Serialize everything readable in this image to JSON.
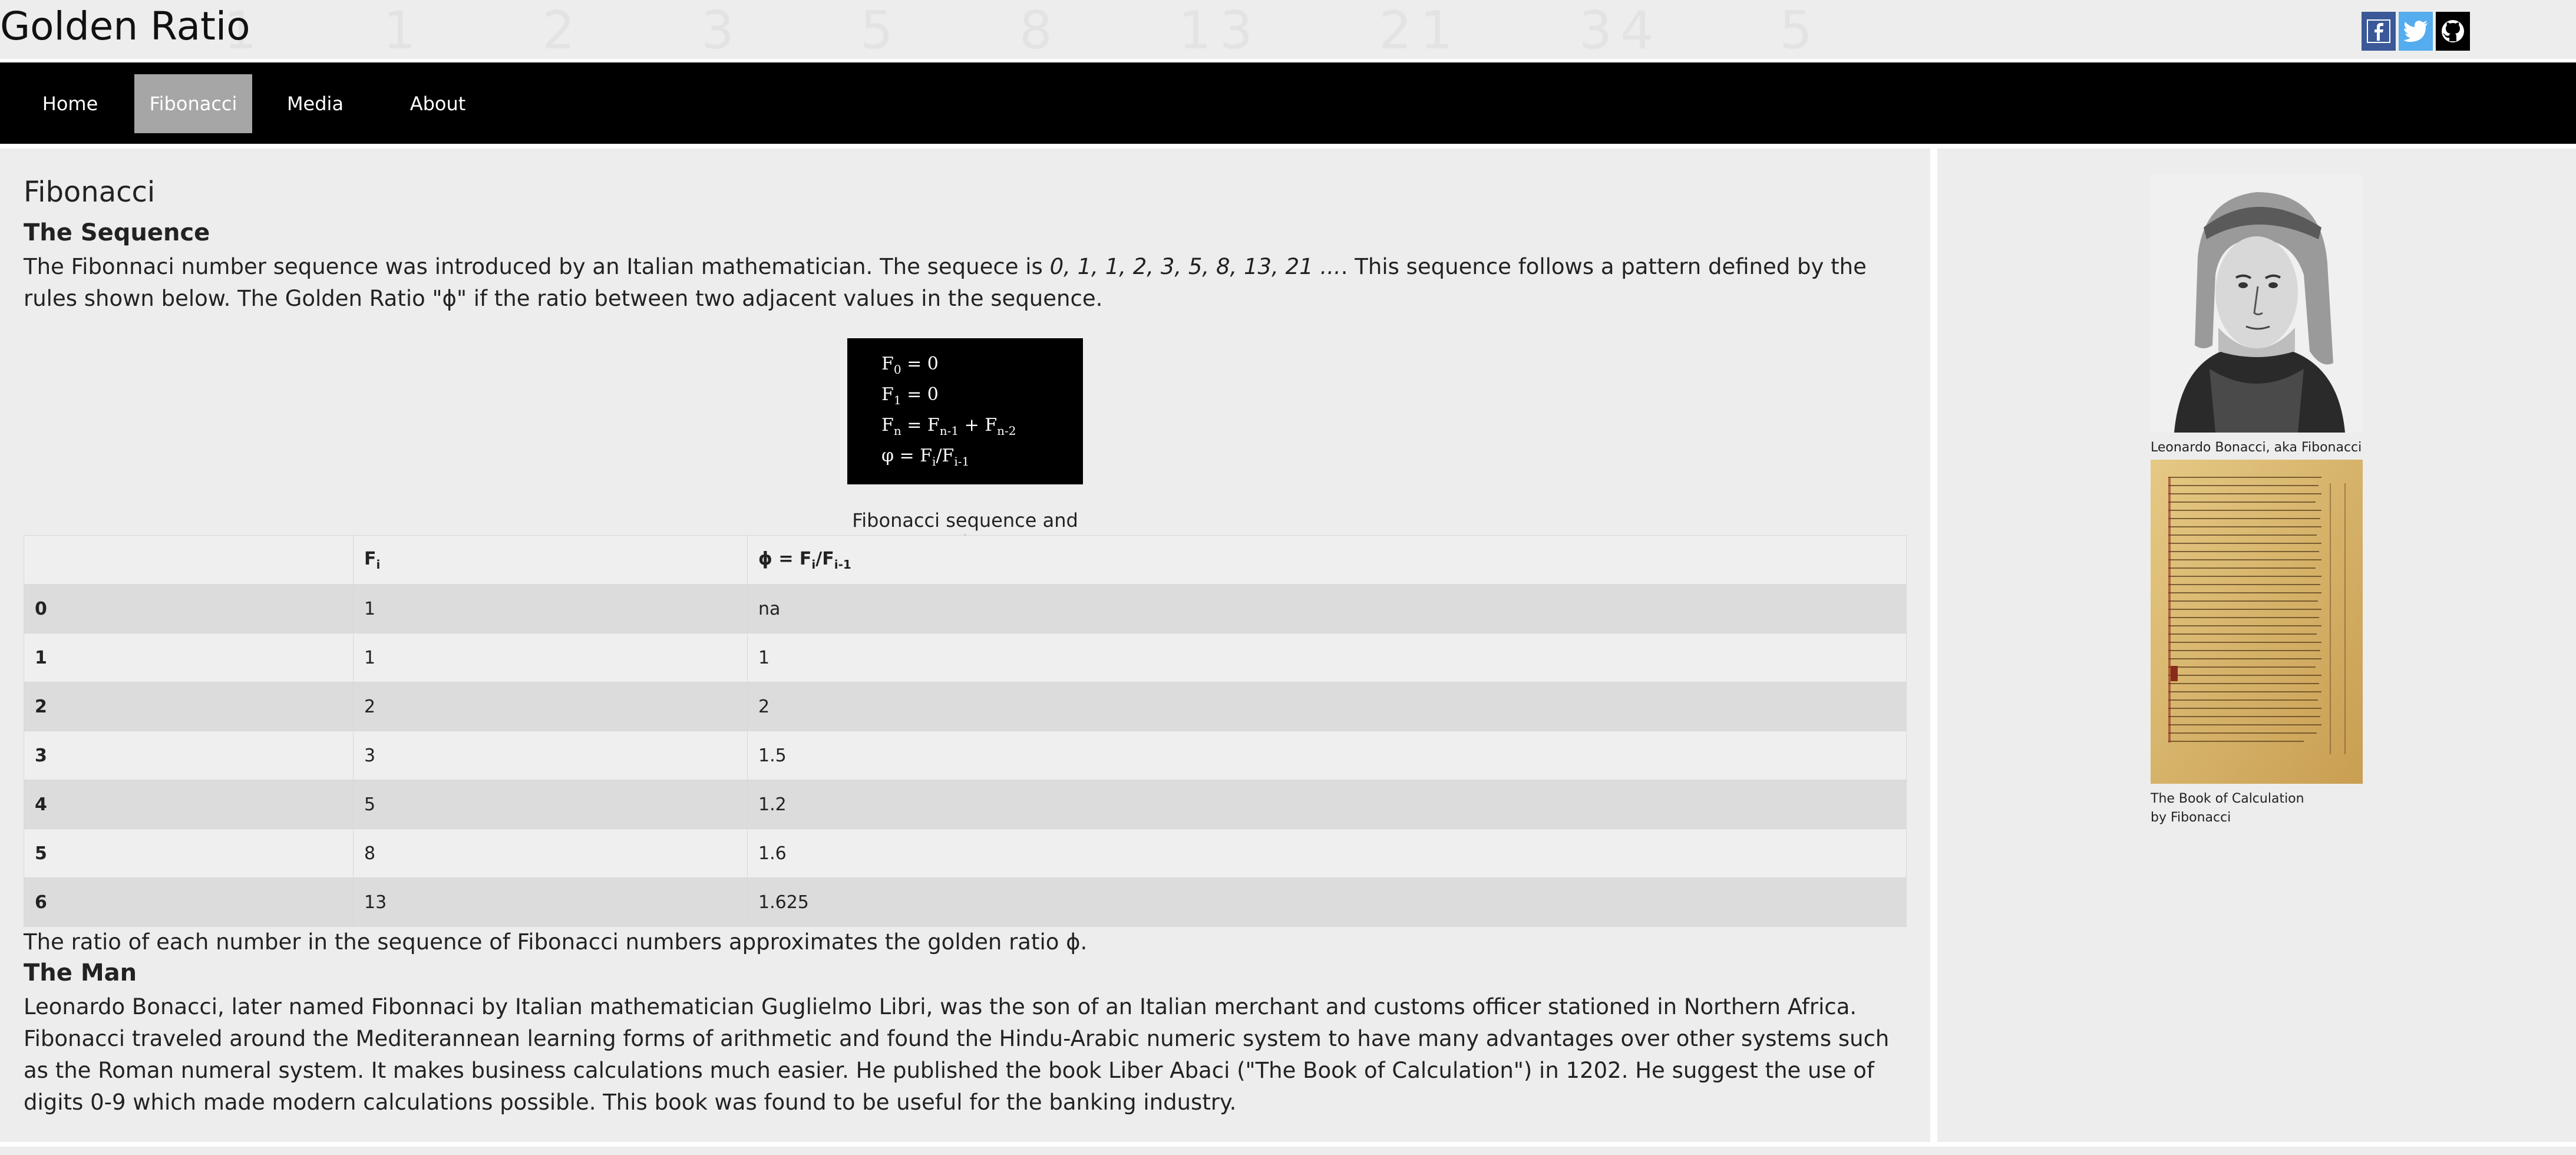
{
  "header": {
    "title": "Golden Ratio",
    "background_numbers": [
      "1",
      "1",
      "2",
      "3",
      "5",
      "8",
      "13",
      "21",
      "34",
      "5"
    ],
    "social": [
      {
        "name": "facebook-icon",
        "color": "#3b5998"
      },
      {
        "name": "twitter-icon",
        "color": "#55acee"
      },
      {
        "name": "github-icon",
        "color": "#000000"
      }
    ]
  },
  "nav": {
    "items": [
      {
        "label": "Home",
        "active": false
      },
      {
        "label": "Fibonacci",
        "active": true
      },
      {
        "label": "Media",
        "active": false
      },
      {
        "label": "About",
        "active": false
      }
    ],
    "active_color": "#a6a6a6"
  },
  "main": {
    "heading": "Fibonacci",
    "sequence_heading": "The Sequence",
    "sequence_text_1": "The Fibonnaci number sequence was introduced by an Italian mathematician. The sequece is ",
    "sequence_values": "0, 1, 1, 2, 3, 5, 8, 13, 21 ...",
    "sequence_text_2": ". This sequence follows a pattern defined by the rules shown below. The Golden Ratio \"ϕ\" if the ratio between two adjacent values in the sequence.",
    "formula": {
      "line1_base": "F",
      "line1_sub": "0",
      "line1_rest": " = 0",
      "line2_base": "F",
      "line2_sub": "1",
      "line2_rest": " = 0",
      "line3_base": "F",
      "line3_sub": "n",
      "line3_mid1": " = F",
      "line3_sub2": "n-1",
      "line3_mid2": " + F",
      "line3_sub3": "n-2",
      "line4_base": "φ = F",
      "line4_sub": "i",
      "line4_mid": "/F",
      "line4_sub2": "i-1"
    },
    "table": {
      "caption": "Fibonacci sequence and ϕ",
      "header_fi_base": "F",
      "header_fi_sub": "i",
      "header_phi_base": "ϕ = F",
      "header_phi_sub1": "i",
      "header_phi_mid": "/F",
      "header_phi_sub2": "i-1",
      "rows": [
        {
          "i": "0",
          "fi": "1",
          "phi": "na"
        },
        {
          "i": "1",
          "fi": "1",
          "phi": "1"
        },
        {
          "i": "2",
          "fi": "2",
          "phi": "2"
        },
        {
          "i": "3",
          "fi": "3",
          "phi": "1.5"
        },
        {
          "i": "4",
          "fi": "5",
          "phi": "1.2"
        },
        {
          "i": "5",
          "fi": "8",
          "phi": "1.6"
        },
        {
          "i": "6",
          "fi": "13",
          "phi": "1.625"
        }
      ]
    },
    "ratio_text": "The ratio of each number in the sequence of Fibonacci numbers approximates the golden ratio ϕ.",
    "man_heading": "The Man",
    "man_text": "Leonardo Bonacci, later named Fibonnaci by Italian mathematician Guglielmo Libri, was the son of an Italian merchant and customs officer stationed in Northern Africa. Fibonacci traveled around the Mediterannean learning forms of arithmetic and found the Hindu-Arabic numeric system to have many advantages over other systems such as the Roman numeral system. It makes business calculations much easier. He published the book Liber Abaci (\"The Book of Calculation\") in 1202. He suggest the use of digits 0-9 which made modern calculations possible. This book was found to be useful for the banking industry."
  },
  "aside": {
    "portrait_caption": "Leonardo Bonacci, aka Fibonacci",
    "book_caption_1": "The Book of Calculation",
    "book_caption_2": "by Fibonacci"
  }
}
